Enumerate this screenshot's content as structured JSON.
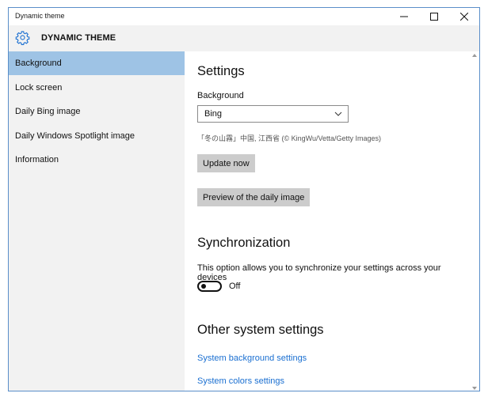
{
  "window": {
    "title": "Dynamic theme",
    "accent": "#5a8ec9"
  },
  "header": {
    "icon": "gear-icon",
    "title": "DYNAMIC THEME",
    "icon_color": "#1a6fd1"
  },
  "sidebar": {
    "selected_color": "#9ec3e5",
    "items": [
      {
        "label": "Background",
        "selected": true
      },
      {
        "label": "Lock screen",
        "selected": false
      },
      {
        "label": "Daily Bing image",
        "selected": false
      },
      {
        "label": "Daily Windows Spotlight image",
        "selected": false
      },
      {
        "label": "Information",
        "selected": false
      }
    ]
  },
  "settings": {
    "heading": "Settings",
    "background_label": "Background",
    "background_value": "Bing",
    "image_caption": "「冬の山霧」中国, 江西省 (© KingWu/Vetta/Getty Images)",
    "update_button": "Update now",
    "preview_button": "Preview of the daily image"
  },
  "synchronization": {
    "heading": "Synchronization",
    "description": "This option allows you to synchronize your settings across your devices",
    "toggle_state": "Off"
  },
  "other": {
    "heading": "Other system settings",
    "links": [
      "System background settings",
      "System colors settings"
    ],
    "link_color": "#1a6fd1"
  }
}
